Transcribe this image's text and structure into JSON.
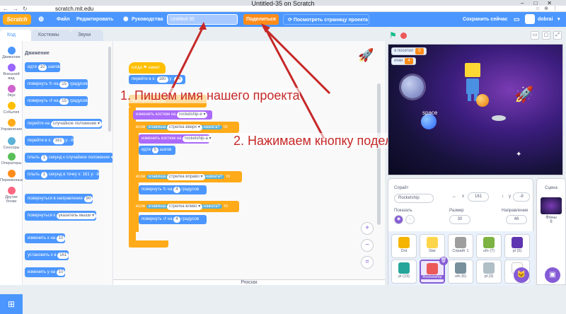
{
  "browser": {
    "window_title": "Untitled-35 on Scratch",
    "url": "scratch.mit.edu"
  },
  "menu": {
    "logo": "Scratch",
    "file": "Файл",
    "edit": "Редактировать",
    "tutorials": "Руководства",
    "project_title": "Untitled-35",
    "share": "Поделиться",
    "see_project": "Посмотреть страницу проекта",
    "save_now": "Сохранить сейчас",
    "user": "dobrai"
  },
  "tabs": {
    "code": "Код",
    "costumes": "Костюмы",
    "sounds": "Звуки"
  },
  "categories": [
    {
      "label": "Движение",
      "color": "#4c97ff"
    },
    {
      "label": "Внешний вид",
      "color": "#9966ff"
    },
    {
      "label": "Звук",
      "color": "#cf63cf"
    },
    {
      "label": "События",
      "color": "#ffbf00"
    },
    {
      "label": "Управление",
      "color": "#ffab19"
    },
    {
      "label": "Сенсоры",
      "color": "#5cb1d6"
    },
    {
      "label": "Операторы",
      "color": "#59c059"
    },
    {
      "label": "Переменные",
      "color": "#ff8c1a"
    },
    {
      "label": "Другие блоки",
      "color": "#ff6680"
    }
  ],
  "palette": {
    "title": "Движение",
    "blocks": [
      {
        "pre": "идти",
        "v1": "10",
        "post": "шагов"
      },
      {
        "pre": "повернуть ↻ на",
        "v1": "15",
        "post": "градусов"
      },
      {
        "pre": "повернуть ↺ на",
        "v1": "15",
        "post": "градусов"
      },
      {
        "pre": "перейти на",
        "v1": "случайное положение ▾",
        "post": ""
      },
      {
        "pre": "перейти в x:",
        "v1": "161",
        "post": "y: -8"
      },
      {
        "pre": "плыть",
        "v1": "1",
        "post": "секунд к случайное положение ▾"
      },
      {
        "pre": "плыть",
        "v1": "1",
        "post": "секунд в точку x: 161 y: -8"
      },
      {
        "pre": "повернуться в направлении",
        "v1": "90",
        "post": ""
      },
      {
        "pre": "повернуться к",
        "v1": "указатель мыши ▾",
        "post": ""
      },
      {
        "pre": "изменить x на",
        "v1": "10",
        "post": ""
      },
      {
        "pre": "установить x в",
        "v1": "161",
        "post": ""
      },
      {
        "pre": "изменить y на",
        "v1": "10",
        "post": ""
      }
    ]
  },
  "script": {
    "hat": "когда  ⚑  нажат",
    "goto_pre": "перейти в x:",
    "goto_x": "180",
    "goto_y_lbl": "y:",
    "goto_y": "14",
    "forever": "повторять всегда",
    "costume1_pre": "изменить костюм на",
    "costume1_val": "rocketship-e ▾",
    "if1_pre": "если",
    "if1_key": "клавиша",
    "if1_keyval": "стрелка вверх ▾",
    "if1_pressed": "нажата?",
    "if1_then": "то",
    "costume2_pre": "изменить костюм на",
    "costume2_val": "rocketship-a ▾",
    "move_pre": "идти",
    "move_val": "5",
    "move_post": "шагов",
    "if2_key": "стрелка вправо ▾",
    "turn_right_pre": "повернуть ↻ на",
    "turn_val": "4",
    "turn_post": "градусов",
    "if3_key": "стрелка влево ▾",
    "turn_left_pre": "повернуть ↺ на"
  },
  "annotations": {
    "step1": "1. Пишем имя нашего проекта",
    "step2": "2. Нажимаем кнопку поделиться"
  },
  "backpack": "Рюкзак",
  "stage": {
    "monitors": [
      {
        "label": "я посетил",
        "value": "0"
      },
      {
        "label": "очки",
        "value": "4"
      }
    ]
  },
  "sprite_info": {
    "sprite_label": "Спрайт",
    "sprite_name": "Rocketship",
    "x_label": "x",
    "x": "161",
    "y_label": "y",
    "y": "-8",
    "show_label": "Показать",
    "size_label": "Размер",
    "size": "30",
    "direction_label": "Направление",
    "direction": "46"
  },
  "sprites": [
    {
      "name": "Dot",
      "color": "#f4b400"
    },
    {
      "name": "Star",
      "color": "#ffd54a"
    },
    {
      "name": "Спрайт 1",
      "color": "#9e9e9e"
    },
    {
      "name": "ufo (7)",
      "color": "#7cb342"
    },
    {
      "name": "pl (5)",
      "color": "#5e35b1"
    },
    {
      "name": "pl (13)",
      "color": "#26a69a"
    },
    {
      "name": "Rocketship",
      "color": "#ec5959"
    },
    {
      "name": "ufo (6)",
      "color": "#78909c"
    },
    {
      "name": "pl (3)",
      "color": "#b0bec5"
    },
    {
      "name": "text",
      "color": "#ffffff"
    }
  ],
  "stage_pane": {
    "title": "Сцена",
    "backdrops_label": "Фоны",
    "backdrops_count": "6"
  }
}
